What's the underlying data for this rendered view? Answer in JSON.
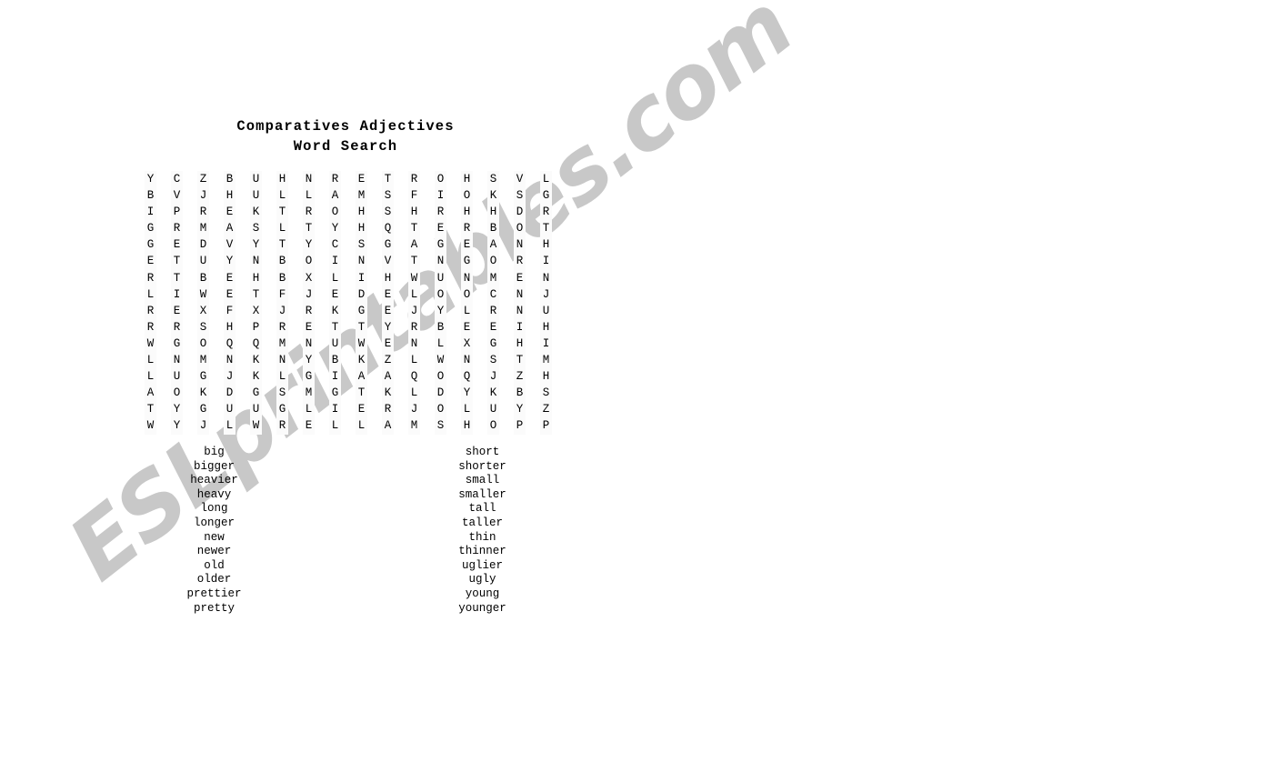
{
  "page": {
    "background_color": "#ffffff",
    "text_color": "#000000"
  },
  "title": {
    "line1": "Comparatives Adjectives",
    "line2": "Word Search"
  },
  "watermark": {
    "text": "ESLprintables.com",
    "color": "#c8c8c8"
  },
  "puzzle": {
    "columns": 16,
    "rows": 16,
    "cell_background": "#fbfbfb",
    "grid": [
      [
        "Y",
        "C",
        "Z",
        "B",
        "U",
        "H",
        "N",
        "R",
        "E",
        "T",
        "R",
        "O",
        "H",
        "S",
        "V",
        "L"
      ],
      [
        "B",
        "V",
        "J",
        "H",
        "U",
        "L",
        "L",
        "A",
        "M",
        "S",
        "F",
        "I",
        "O",
        "K",
        "S",
        "G"
      ],
      [
        "I",
        "P",
        "R",
        "E",
        "K",
        "T",
        "R",
        "O",
        "H",
        "S",
        "H",
        "R",
        "H",
        "H",
        "D",
        "R"
      ],
      [
        "G",
        "R",
        "M",
        "A",
        "S",
        "L",
        "T",
        "Y",
        "H",
        "Q",
        "T",
        "E",
        "R",
        "B",
        "O",
        "T"
      ],
      [
        "G",
        "E",
        "D",
        "V",
        "Y",
        "T",
        "Y",
        "C",
        "S",
        "G",
        "A",
        "G",
        "E",
        "A",
        "N",
        "H"
      ],
      [
        "E",
        "T",
        "U",
        "Y",
        "N",
        "B",
        "O",
        "I",
        "N",
        "V",
        "T",
        "N",
        "G",
        "O",
        "R",
        "I"
      ],
      [
        "R",
        "T",
        "B",
        "E",
        "H",
        "B",
        "X",
        "L",
        "I",
        "H",
        "W",
        "U",
        "N",
        "M",
        "E",
        "N"
      ],
      [
        "L",
        "I",
        "W",
        "E",
        "T",
        "F",
        "J",
        "E",
        "D",
        "E",
        "L",
        "O",
        "O",
        "C",
        "N",
        "J"
      ],
      [
        "R",
        "E",
        "X",
        "F",
        "X",
        "J",
        "R",
        "K",
        "G",
        "E",
        "J",
        "Y",
        "L",
        "R",
        "N",
        "U"
      ],
      [
        "R",
        "R",
        "S",
        "H",
        "P",
        "R",
        "E",
        "T",
        "T",
        "Y",
        "R",
        "B",
        "E",
        "E",
        "I",
        "H"
      ],
      [
        "W",
        "G",
        "O",
        "Q",
        "Q",
        "M",
        "N",
        "U",
        "W",
        "E",
        "N",
        "L",
        "X",
        "G",
        "H",
        "I"
      ],
      [
        "L",
        "N",
        "M",
        "N",
        "K",
        "N",
        "Y",
        "B",
        "K",
        "Z",
        "L",
        "W",
        "N",
        "S",
        "T",
        "M"
      ],
      [
        "L",
        "U",
        "G",
        "J",
        "K",
        "L",
        "G",
        "I",
        "A",
        "A",
        "Q",
        "O",
        "Q",
        "J",
        "Z",
        "H"
      ],
      [
        "A",
        "O",
        "K",
        "D",
        "G",
        "S",
        "M",
        "G",
        "T",
        "K",
        "L",
        "D",
        "Y",
        "K",
        "B",
        "S"
      ],
      [
        "T",
        "Y",
        "G",
        "U",
        "U",
        "G",
        "L",
        "I",
        "E",
        "R",
        "J",
        "O",
        "L",
        "U",
        "Y",
        "Z"
      ],
      [
        "W",
        "Y",
        "J",
        "L",
        "W",
        "R",
        "E",
        "L",
        "L",
        "A",
        "M",
        "S",
        "H",
        "O",
        "P",
        "P"
      ]
    ]
  },
  "word_list": {
    "left_column": [
      "big",
      "bigger",
      "heavier",
      "heavy",
      "long",
      "longer",
      "new",
      "newer",
      "old",
      "older",
      "prettier",
      "pretty"
    ],
    "right_column": [
      "short",
      "shorter",
      "small",
      "smaller",
      "tall",
      "taller",
      "thin",
      "thinner",
      "uglier",
      "ugly",
      "young",
      "younger"
    ]
  }
}
